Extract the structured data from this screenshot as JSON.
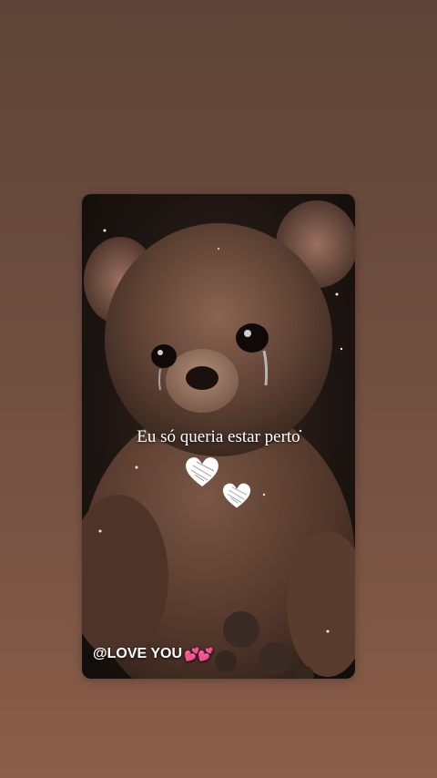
{
  "card": {
    "caption": "Eu só queria estar perto",
    "watermark": "@LOVE YOU",
    "watermark_hearts": "💕💕"
  },
  "icons": {
    "heart_1": "white-scribble-heart-icon",
    "heart_2": "white-scribble-heart-icon"
  },
  "colors": {
    "background": "#6b4c3e",
    "bear_fur": "#6e4e3e",
    "text": "#ffffff",
    "pink_hearts": "#ff4fb5"
  }
}
